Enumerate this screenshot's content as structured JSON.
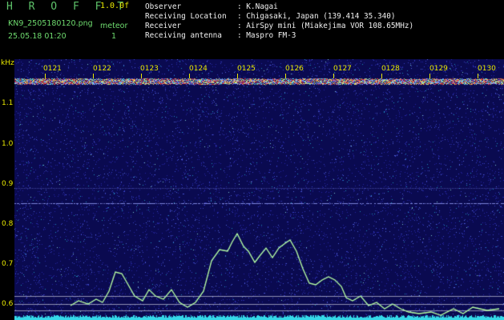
{
  "app": {
    "title": "H R O F F T",
    "version": "1.0.0f"
  },
  "file": {
    "name": "KN9_2505180120.png",
    "datetime": "25.05.18 01:20"
  },
  "meteor": {
    "label": "meteor",
    "count": "1"
  },
  "info": [
    {
      "label": "Observer",
      "value": ": K.Nagai"
    },
    {
      "label": "Receiving Location",
      "value": ": Chigasaki, Japan (139.414 35.340)"
    },
    {
      "label": "Receiver",
      "value": ": AirSpy mini (Miakejima VOR 108.65MHz)"
    },
    {
      "label": "Receiving antenna",
      "value": ": Maspro FM-3"
    }
  ],
  "axis": {
    "unit": "kHz",
    "y_labels": [
      "1.1",
      "1.0",
      "0.9",
      "0.8",
      "0.7",
      "0.6"
    ],
    "time_ticks": [
      "0121",
      "0122",
      "0123",
      "0124",
      "0125",
      "0126",
      "0127",
      "0128",
      "0129",
      "0130"
    ]
  },
  "colors": {
    "label": "#e8e800",
    "header_green": "#6fdc6f",
    "trace": "#9cffb0",
    "background": "#0b0b55"
  }
}
